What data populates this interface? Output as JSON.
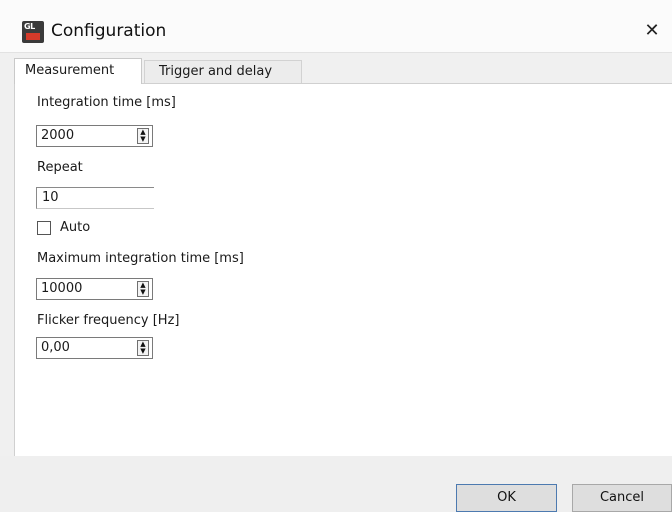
{
  "window": {
    "title": "Configuration",
    "close_glyph": "✕",
    "app_icon_text": "GL"
  },
  "tabs": [
    {
      "label": "Measurement",
      "active": true
    },
    {
      "label": "Trigger and delay",
      "active": false
    }
  ],
  "measurement": {
    "integration_time": {
      "label": "Integration time [ms]",
      "value": "2000"
    },
    "repeat": {
      "label": "Repeat",
      "value": "10"
    },
    "auto": {
      "label": "Auto",
      "checked": false
    },
    "max_integration_time": {
      "label": "Maximum integration time [ms]",
      "value": "10000"
    },
    "flicker_frequency": {
      "label": "Flicker frequency [Hz]",
      "value": "0,00"
    }
  },
  "spin_arrows": "▲▼",
  "buttons": {
    "ok": "OK",
    "cancel": "Cancel"
  }
}
